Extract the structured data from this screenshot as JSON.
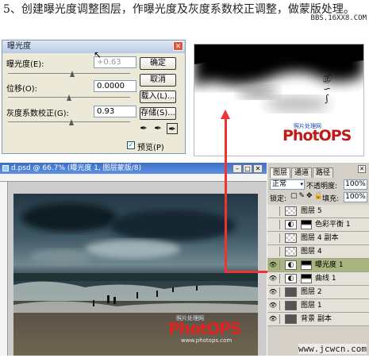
{
  "caption": "5、创建曝光度调整图层，作曝光度及灰度系数校正调整，做蒙版处理。",
  "watermark_top": "BBS.16XX8.COM",
  "watermark_bottom": "www.jcwcn.com",
  "dialog": {
    "title": "曝光度",
    "fields": [
      {
        "label": "曝光度(E):",
        "value": "+0.63"
      },
      {
        "label": "位移(O):",
        "value": "0.0000"
      },
      {
        "label": "灰度系数校正(G):",
        "value": "0.93"
      }
    ],
    "buttons": [
      "确定",
      "取消",
      "载入(L)...",
      "存储(S)..."
    ],
    "preview_label": "预览(P)",
    "preview_checked": true
  },
  "preview_logo": {
    "brand": "PhotOPS",
    "sub": "照片处理网"
  },
  "document": {
    "title": "d.psd @ 66.7% (曝光度 1, 图层蒙版/8)"
  },
  "photo_logo": {
    "brand": "PhotOPS",
    "sub": "照片处理网",
    "url": "www.photops.com"
  },
  "layers_panel": {
    "tabs": [
      "图层",
      "通道",
      "路径"
    ],
    "blend_mode": "正常",
    "opacity_label": "不透明度:",
    "opacity": "100%",
    "lock_label": "锁定:",
    "fill_label": "填充:",
    "fill": "100%",
    "layers": [
      {
        "name": "图层 5",
        "type": "pixel",
        "visible": false,
        "selected": false
      },
      {
        "name": "色彩平衡 1",
        "type": "adjust",
        "visible": false,
        "selected": false
      },
      {
        "name": "图层 4 副本",
        "type": "pixel",
        "visible": false,
        "selected": false
      },
      {
        "name": "图层 4",
        "type": "pixel",
        "visible": false,
        "selected": false
      },
      {
        "name": "曝光度 1",
        "type": "adjust",
        "visible": true,
        "selected": true
      },
      {
        "name": "曲线 1",
        "type": "adjust",
        "visible": true,
        "selected": false
      },
      {
        "name": "图层 2",
        "type": "pixel",
        "visible": true,
        "selected": false
      },
      {
        "name": "图层 1",
        "type": "pixel",
        "visible": true,
        "selected": false
      },
      {
        "name": "背景 副本",
        "type": "pixel",
        "visible": true,
        "selected": false
      }
    ]
  },
  "colors": {
    "arrow": "#e33333",
    "selected_layer": "#a9b47f",
    "title_bar": "#3b6fc7"
  }
}
